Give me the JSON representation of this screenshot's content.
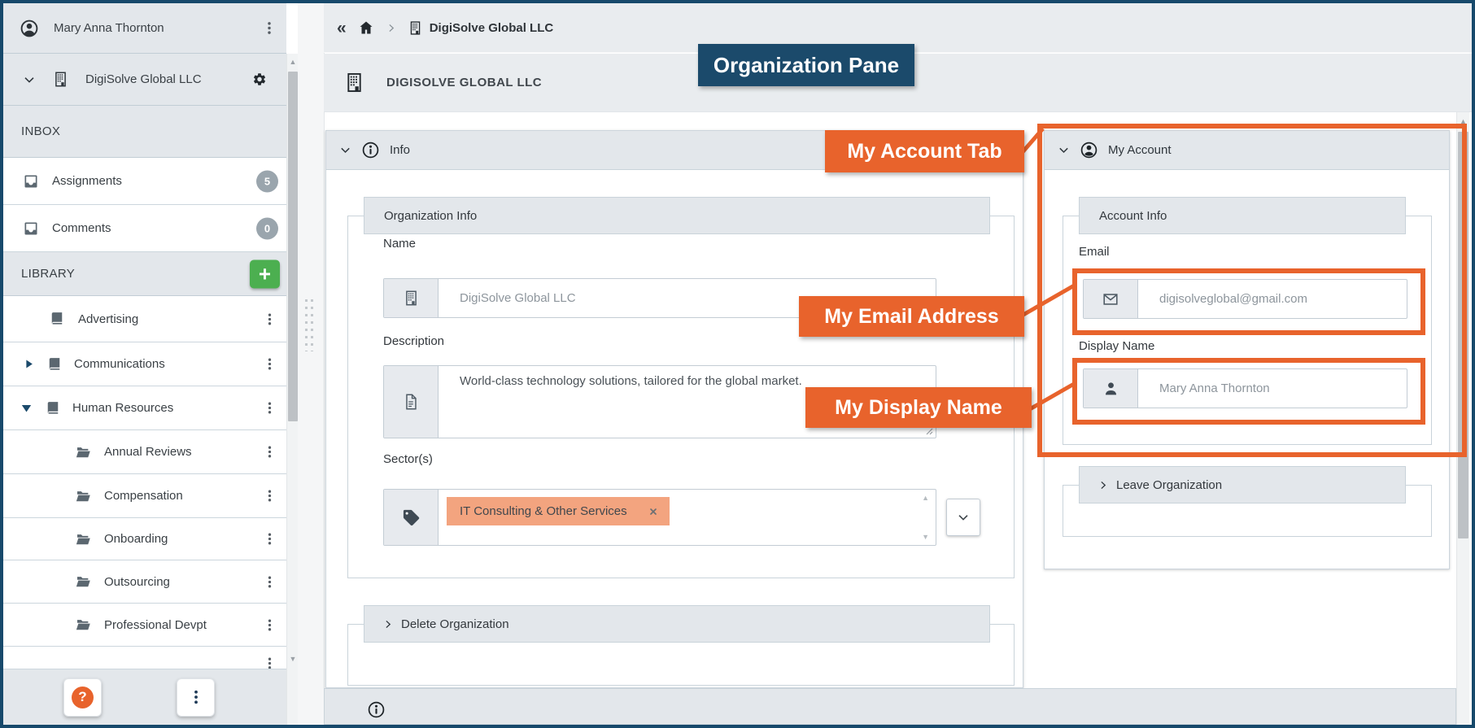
{
  "colors": {
    "annotation_orange": "#E8632C",
    "annotation_navy": "#1B4A6B",
    "sector_tag_fill": "#F3A47F",
    "add_button_green": "#4CAF50",
    "help_icon_orange": "#E8632C",
    "badge_gray": "#9AA5AD",
    "frame_navy": "#17496B"
  },
  "icons": [
    "user-avatar-icon",
    "kebab-icon",
    "chevron-down-icon",
    "building-icon",
    "gear-icon",
    "inbox-tray-icon",
    "book-icon",
    "open-folder-icon",
    "triangle-collapsed-icon",
    "triangle-expanded-icon",
    "add-plus-icon",
    "help-question-icon",
    "back-chevrons-icon",
    "home-icon",
    "breadcrumb-separator-icon",
    "info-icon",
    "person-circle-icon",
    "envelope-icon",
    "person-icon",
    "tag-icon",
    "document-icon",
    "remove-tag-icon",
    "dropdown-chevron-icon",
    "chevron-right-icon"
  ],
  "sidebar": {
    "user": {
      "name": "Mary Anna Thornton"
    },
    "organization": {
      "name": "DigiSolve Global LLC"
    },
    "inbox": {
      "label": "INBOX",
      "items": [
        {
          "label": "Assignments",
          "badge": "5"
        },
        {
          "label": "Comments",
          "badge": "0"
        }
      ]
    },
    "library": {
      "label": "LIBRARY",
      "items": [
        {
          "label": "Advertising",
          "icon": "book",
          "state": "none"
        },
        {
          "label": "Communications",
          "icon": "book",
          "state": "collapsed"
        },
        {
          "label": "Human Resources",
          "icon": "book",
          "state": "expanded"
        },
        {
          "label": "Annual Reviews",
          "icon": "folder",
          "state": "child"
        },
        {
          "label": "Compensation",
          "icon": "folder",
          "state": "child"
        },
        {
          "label": "Onboarding",
          "icon": "folder",
          "state": "child"
        },
        {
          "label": "Outsourcing",
          "icon": "folder",
          "state": "child"
        },
        {
          "label": "Professional Devpt",
          "icon": "folder",
          "state": "child"
        }
      ]
    }
  },
  "main": {
    "breadcrumb": {
      "current": "DigiSolve Global LLC"
    },
    "title": "DIGISOLVE GLOBAL LLC",
    "info": {
      "header": "Info",
      "group": "Organization Info",
      "name_label": "Name",
      "name_value": "DigiSolve Global LLC",
      "description_label": "Description",
      "description_value": "World-class technology solutions, tailored for the global market.",
      "sectors_label": "Sector(s)",
      "sector_tag": "IT Consulting & Other Services",
      "delete_header": "Delete Organization"
    },
    "account": {
      "header": "My Account",
      "group": "Account Info",
      "email_label": "Email",
      "email_value": "digisolveglobal@gmail.com",
      "display_label": "Display Name",
      "display_value": "Mary Anna Thornton",
      "leave_header": "Leave Organization"
    }
  },
  "annotations": {
    "pane": "Organization Pane",
    "tab": "My Account Tab",
    "email": "My Email Address",
    "display": "My Display Name"
  }
}
